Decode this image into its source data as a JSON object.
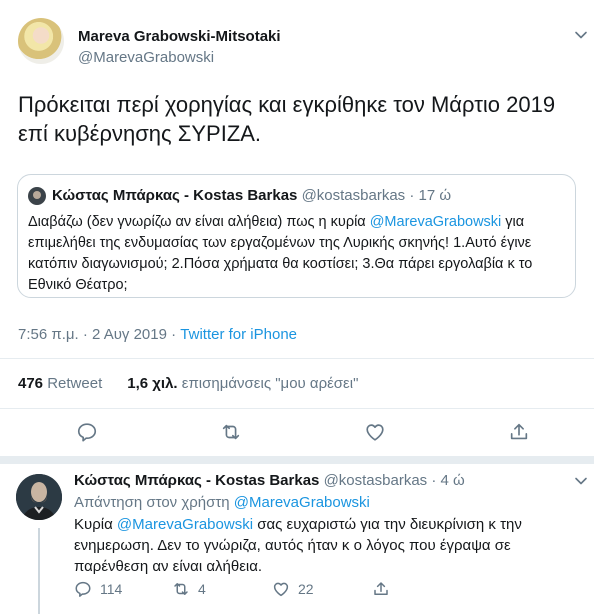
{
  "tweet": {
    "author_name": "Mareva Grabowski-Mitsotaki",
    "author_handle": "@MarevaGrabowski",
    "text": "Πρόκειται περί χορηγίας  και εγκρίθηκε τον Μάρτιο 2019 επί κυβέρνησης ΣΥΡΙΖΑ.",
    "quoted": {
      "author_name": "Κώστας Μπάρκας - Kostas Barkas",
      "author_handle": "@kostasbarkas",
      "time": "· 17 ώ",
      "text_before": "Διαβάζω (δεν γνωρίζω αν είναι αλήθεια) πως η κυρία ",
      "mention": "@MarevaGrabowski",
      "text_after": " για επιμελήθει της ενδυμασίας των εργαζομένων της Λυρικής σκηνής! 1.Αυτό έγινε κατόπιν διαγωνισμού; 2.Πόσα χρήματα θα κοστίσει; 3.Θα πάρει εργολαβία κ το Εθνικό Θέατρο;"
    },
    "timestamp": "7:56 π.μ. · 2 Αυγ 2019 · ",
    "source": "Twitter for iPhone",
    "retweets_count": "476",
    "retweets_label": "Retweet",
    "likes_count": "1,6 χιλ.",
    "likes_label": "επισημάνσεις \"μου αρέσει\""
  },
  "reply": {
    "author_name": "Κώστας Μπάρκας - Kostas Barkas",
    "author_handle": "@kostasbarkas",
    "time": "· 4 ώ",
    "replying_to_label": "Απάντηση στον χρήστη ",
    "replying_to_handle": "@MarevaGrabowski",
    "text_before": "Κυρία ",
    "mention": "@MarevaGrabowski",
    "text_after": " σας ευχαριστώ για την διευκρίνιση κ την ενημερωση. Δεν το γνώριζα, αυτός ήταν κ ο λόγος που έγραψα σε παρένθεση αν είναι αλήθεια.",
    "reply_count": "114",
    "retweet_count": "4",
    "like_count": "22"
  },
  "icons": {
    "menu": "chevron-down-icon",
    "reply": "reply-icon",
    "retweet": "retweet-icon",
    "like": "heart-icon",
    "share": "share-icon"
  },
  "colors": {
    "link": "#1b95e0",
    "secondary": "#657786",
    "border": "#e6ecf0"
  }
}
